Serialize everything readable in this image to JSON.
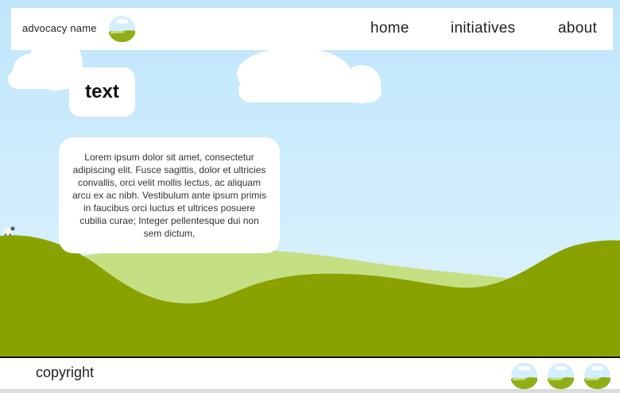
{
  "header": {
    "brand": "advocacy name",
    "nav": [
      {
        "label": "home"
      },
      {
        "label": "initiatives"
      },
      {
        "label": "about"
      }
    ]
  },
  "hero": {
    "title": "text",
    "body": "Lorem ipsum dolor sit amet, consectetur adipiscing elit. Fusce sagittis, dolor et ultricies convallis, orci velit mollis lectus, ac aliquam arcu ex ac nibh. Vestibulum ante ipsum primis in faucibus orci luctus et ultrices posuere cubilia curae; Integer pellentesque dui non sem dictum,"
  },
  "footer": {
    "copyright": "copyright"
  },
  "icons": {
    "logo": "globe-landscape-icon",
    "social": [
      "globe-landscape-icon",
      "globe-landscape-icon",
      "globe-landscape-icon"
    ]
  },
  "colors": {
    "sky": "#c9ebfb",
    "hill_dark": "#89a200",
    "hill_light": "#c5df83",
    "cloud": "#ffffff",
    "card": "#ffffff"
  }
}
